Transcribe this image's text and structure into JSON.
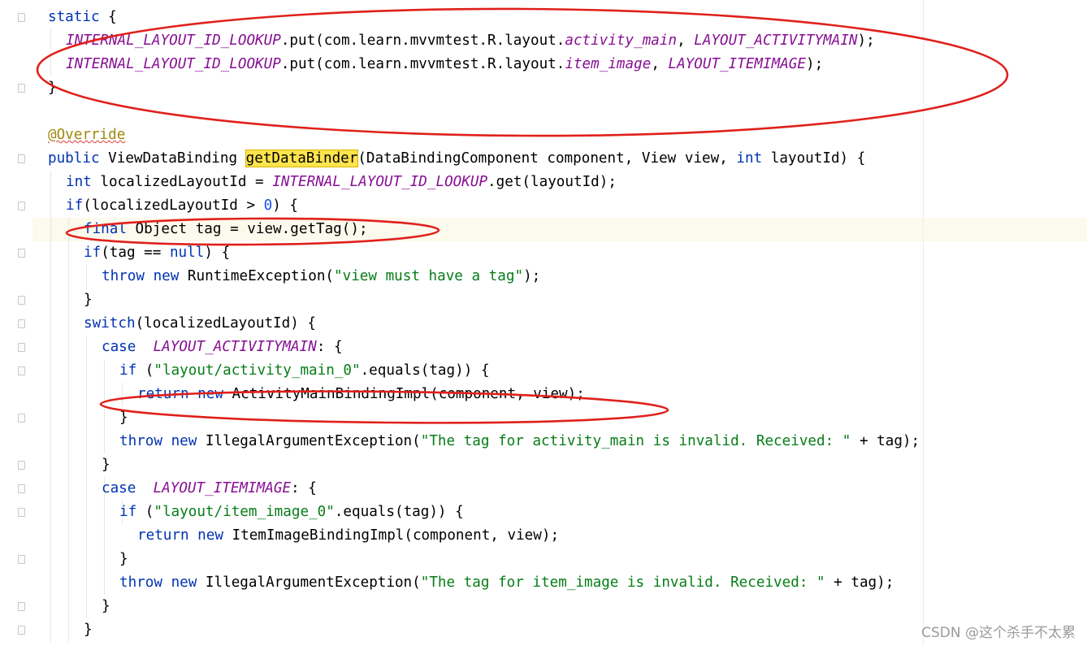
{
  "editor": {
    "lines": [
      {
        "indent": 0,
        "tokens": [
          {
            "t": "static",
            "c": "kw"
          },
          {
            "t": " {"
          }
        ]
      },
      {
        "indent": 1,
        "tokens": [
          {
            "t": "INTERNAL_LAYOUT_ID_LOOKUP",
            "c": "const"
          },
          {
            "t": ".put(com.learn.mvvmtest.R.layout."
          },
          {
            "t": "activity_main",
            "c": "fld"
          },
          {
            "t": ", "
          },
          {
            "t": "LAYOUT_ACTIVITYMAIN",
            "c": "const"
          },
          {
            "t": ");"
          }
        ]
      },
      {
        "indent": 1,
        "tokens": [
          {
            "t": "INTERNAL_LAYOUT_ID_LOOKUP",
            "c": "const"
          },
          {
            "t": ".put(com.learn.mvvmtest.R.layout."
          },
          {
            "t": "item_image",
            "c": "fld"
          },
          {
            "t": ", "
          },
          {
            "t": "LAYOUT_ITEMIMAGE",
            "c": "const"
          },
          {
            "t": ");"
          }
        ]
      },
      {
        "indent": 0,
        "tokens": [
          {
            "t": "}"
          }
        ]
      },
      {
        "indent": 0,
        "tokens": []
      },
      {
        "indent": 0,
        "tokens": [
          {
            "t": "@Override",
            "c": "ann"
          }
        ]
      },
      {
        "indent": 0,
        "tokens": [
          {
            "t": "public",
            "c": "kw"
          },
          {
            "t": " ViewDataBinding "
          },
          {
            "t": "getDataBinder",
            "c": "hl"
          },
          {
            "t": "(DataBindingComponent component, View view, "
          },
          {
            "t": "int",
            "c": "kw"
          },
          {
            "t": " layoutId) {"
          }
        ]
      },
      {
        "indent": 1,
        "tokens": [
          {
            "t": "int",
            "c": "kw"
          },
          {
            "t": " localizedLayoutId = "
          },
          {
            "t": "INTERNAL_LAYOUT_ID_LOOKUP",
            "c": "const"
          },
          {
            "t": ".get(layoutId);"
          }
        ]
      },
      {
        "indent": 1,
        "tokens": [
          {
            "t": "if",
            "c": "kw"
          },
          {
            "t": "(localizedLayoutId > "
          },
          {
            "t": "0",
            "c": "num"
          },
          {
            "t": ") {"
          }
        ]
      },
      {
        "indent": 2,
        "tokens": [
          {
            "t": "final",
            "c": "kw"
          },
          {
            "t": " Object tag = view.getTag();"
          }
        ]
      },
      {
        "indent": 2,
        "tokens": [
          {
            "t": "if",
            "c": "kw"
          },
          {
            "t": "(tag == "
          },
          {
            "t": "null",
            "c": "kw"
          },
          {
            "t": ") {"
          }
        ]
      },
      {
        "indent": 3,
        "tokens": [
          {
            "t": "throw",
            "c": "kw"
          },
          {
            "t": " "
          },
          {
            "t": "new",
            "c": "kw"
          },
          {
            "t": " RuntimeException("
          },
          {
            "t": "\"view must have a tag\"",
            "c": "str"
          },
          {
            "t": ");"
          }
        ]
      },
      {
        "indent": 2,
        "tokens": [
          {
            "t": "}"
          }
        ]
      },
      {
        "indent": 2,
        "tokens": [
          {
            "t": "switch",
            "c": "kw"
          },
          {
            "t": "(localizedLayoutId) {"
          }
        ]
      },
      {
        "indent": 3,
        "tokens": [
          {
            "t": "case",
            "c": "kw"
          },
          {
            "t": "  "
          },
          {
            "t": "LAYOUT_ACTIVITYMAIN",
            "c": "const"
          },
          {
            "t": ": {"
          }
        ]
      },
      {
        "indent": 4,
        "tokens": [
          {
            "t": "if",
            "c": "kw"
          },
          {
            "t": " ("
          },
          {
            "t": "\"layout/activity_main_0\"",
            "c": "str"
          },
          {
            "t": ".equals(tag)) {"
          }
        ]
      },
      {
        "indent": 5,
        "tokens": [
          {
            "t": "return",
            "c": "kw"
          },
          {
            "t": " "
          },
          {
            "t": "new",
            "c": "kw"
          },
          {
            "t": " ActivityMainBindingImpl(component, view);"
          }
        ]
      },
      {
        "indent": 4,
        "tokens": [
          {
            "t": "}"
          }
        ]
      },
      {
        "indent": 4,
        "tokens": [
          {
            "t": "throw",
            "c": "kw"
          },
          {
            "t": " "
          },
          {
            "t": "new",
            "c": "kw"
          },
          {
            "t": " IllegalArgumentException("
          },
          {
            "t": "\"The tag for activity_main is invalid. Received: \"",
            "c": "str"
          },
          {
            "t": " + tag);"
          }
        ]
      },
      {
        "indent": 3,
        "tokens": [
          {
            "t": "}"
          }
        ]
      },
      {
        "indent": 3,
        "tokens": [
          {
            "t": "case",
            "c": "kw"
          },
          {
            "t": "  "
          },
          {
            "t": "LAYOUT_ITEMIMAGE",
            "c": "const"
          },
          {
            "t": ": {"
          }
        ]
      },
      {
        "indent": 4,
        "tokens": [
          {
            "t": "if",
            "c": "kw"
          },
          {
            "t": " ("
          },
          {
            "t": "\"layout/item_image_0\"",
            "c": "str"
          },
          {
            "t": ".equals(tag)) {"
          }
        ]
      },
      {
        "indent": 5,
        "tokens": [
          {
            "t": "return",
            "c": "kw"
          },
          {
            "t": " "
          },
          {
            "t": "new",
            "c": "kw"
          },
          {
            "t": " ItemImageBindingImpl(component, view);"
          }
        ]
      },
      {
        "indent": 4,
        "tokens": [
          {
            "t": "}"
          }
        ]
      },
      {
        "indent": 4,
        "tokens": [
          {
            "t": "throw",
            "c": "kw"
          },
          {
            "t": " "
          },
          {
            "t": "new",
            "c": "kw"
          },
          {
            "t": " IllegalArgumentException("
          },
          {
            "t": "\"The tag for item_image is invalid. Received: \"",
            "c": "str"
          },
          {
            "t": " + tag);"
          }
        ]
      },
      {
        "indent": 3,
        "tokens": [
          {
            "t": "}"
          }
        ]
      },
      {
        "indent": 2,
        "tokens": [
          {
            "t": "}"
          }
        ]
      }
    ]
  },
  "watermark": "CSDN @这个杀手不太累",
  "colors": {
    "keyword": "#0033b3",
    "constant": "#871094",
    "string": "#067d17",
    "number": "#1750eb",
    "annotation": "#9e880d",
    "highlight": "#ffe44d",
    "caret_row": "#fcfaed",
    "marker": "#e0201b"
  },
  "icons": [
    "fold-marker-icon"
  ]
}
